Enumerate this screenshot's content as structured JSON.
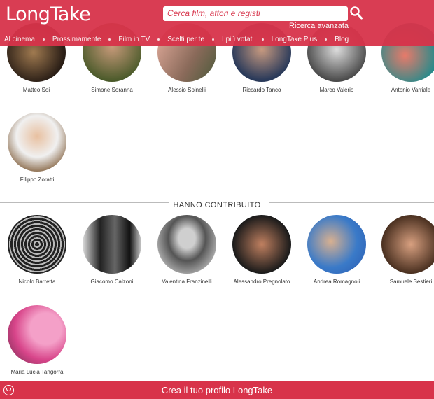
{
  "header": {
    "logo": "LongTake",
    "search_placeholder": "Cerca film, attori e registi",
    "advanced_search": "Ricerca avanzata",
    "nav": [
      "Al cinema",
      "Prossimamente",
      "Film in TV",
      "Scelti per te",
      "I più votati",
      "LongTake Plus",
      "Blog"
    ]
  },
  "team": [
    {
      "name": "Matteo Soi",
      "color": "#4a3a2e"
    },
    {
      "name": "Simone Soranna",
      "color": "#6a7a3a"
    },
    {
      "name": "Alessio Spinelli",
      "color": "#b87a6a"
    },
    {
      "name": "Riccardo Tanco",
      "color": "#3a4a6a"
    },
    {
      "name": "Marco Valerio",
      "color": "#777777"
    },
    {
      "name": "Antonio Varriale",
      "color": "#3a8a8a"
    },
    {
      "name": "Filippo Zoratti",
      "color": "#8a7a5a"
    }
  ],
  "contributors_title": "HANNO CONTRIBUITO",
  "contributors": [
    {
      "name": "Nicolo Barretta",
      "color": "#555555"
    },
    {
      "name": "Giacomo Calzoni",
      "color": "#444444"
    },
    {
      "name": "Valentina Franzinelli",
      "color": "#999999"
    },
    {
      "name": "Alessandro Pregnolato",
      "color": "#7a4a3a"
    },
    {
      "name": "Andrea Romagnoli",
      "color": "#3a7ac8"
    },
    {
      "name": "Samuele Sestieri",
      "color": "#6a4a3a"
    },
    {
      "name": "Maria Lucia Tangorra",
      "color": "#d85a8a"
    }
  ],
  "footer": {
    "label": "Crea il tuo profilo LongTake"
  },
  "colors": {
    "brand": "#d8334a"
  }
}
